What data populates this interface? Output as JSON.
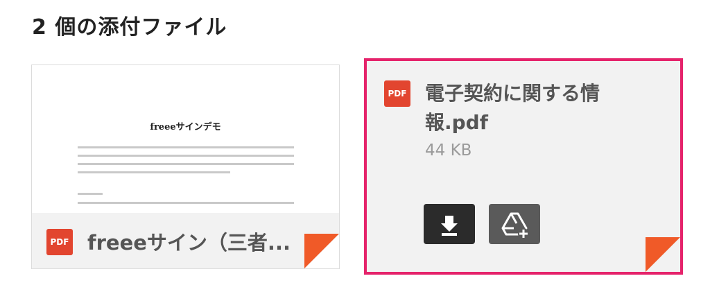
{
  "heading": "2 個の添付ファイル",
  "attachments": [
    {
      "name": "freeeサイン（三者...",
      "type_badge": "PDF",
      "preview": {
        "title": "freeeサインデモ"
      }
    },
    {
      "name": "電子契約に関する情報.pdf",
      "type_badge": "PDF",
      "size": "44 KB",
      "selected": true,
      "actions": [
        {
          "icon": "download-icon"
        },
        {
          "icon": "add-to-drive-icon"
        }
      ]
    }
  ],
  "colors": {
    "pdf_red": "#e2452f",
    "selection_border": "#e5236b",
    "fold_orange": "#f05a28"
  }
}
